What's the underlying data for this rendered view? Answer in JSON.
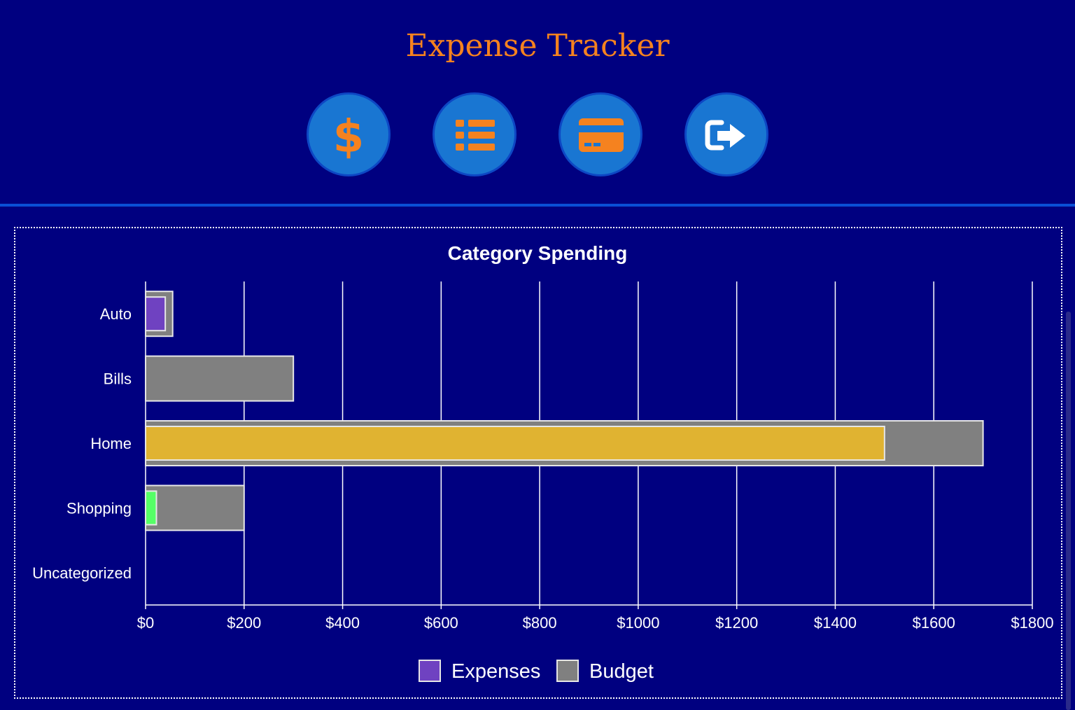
{
  "app": {
    "title": "Expense Tracker"
  },
  "nav": {
    "buttons": [
      {
        "icon": "dollar-icon"
      },
      {
        "icon": "list-icon"
      },
      {
        "icon": "credit-card-icon"
      },
      {
        "icon": "sign-out-icon"
      }
    ]
  },
  "colors": {
    "background": "#000080",
    "accent": "#f5821f",
    "button": "#1976d2",
    "budget": "#808080",
    "expenses_legend": "#6f42c1"
  },
  "chart_data": {
    "type": "bar",
    "orientation": "horizontal",
    "title": "Category Spending",
    "categories": [
      "Auto",
      "Bills",
      "Home",
      "Shopping",
      "Uncategorized"
    ],
    "series": [
      {
        "name": "Budget",
        "values": [
          55,
          300,
          1700,
          200,
          0
        ],
        "color": "#808080"
      },
      {
        "name": "Expenses",
        "values": [
          40,
          0,
          1500,
          22,
          0
        ],
        "colors": [
          "#6f42c1",
          "#6f42c1",
          "#e0b331",
          "#55ff66",
          "#6f42c1"
        ]
      }
    ],
    "xlim": [
      0,
      1800
    ],
    "xticks": [
      0,
      200,
      400,
      600,
      800,
      1000,
      1200,
      1400,
      1600,
      1800
    ],
    "tick_prefix": "$",
    "grid": true,
    "legend": [
      {
        "label": "Expenses",
        "color": "#6f42c1"
      },
      {
        "label": "Budget",
        "color": "#808080"
      }
    ],
    "legend_position": "bottom"
  }
}
